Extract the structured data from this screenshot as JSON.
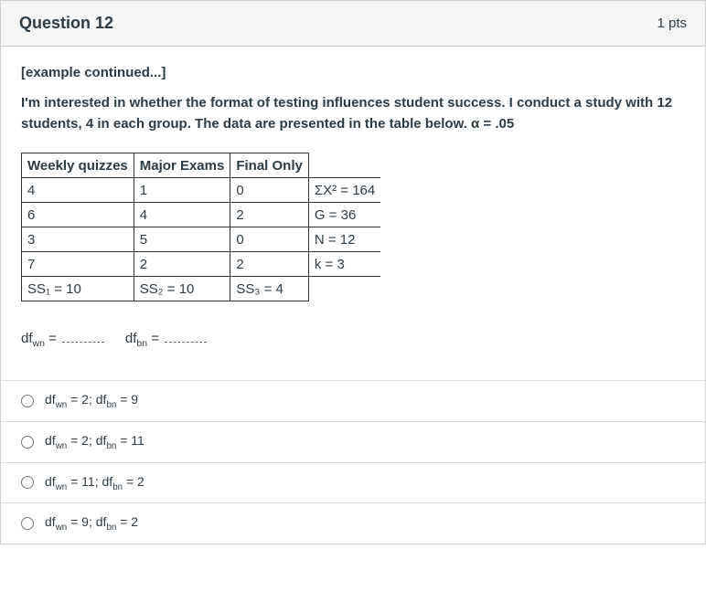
{
  "header": {
    "title": "Question 12",
    "points": "1 pts"
  },
  "prompt": {
    "sub": "[example continued...]",
    "main": "I'm interested in whether the format of testing influences student success.  I conduct a study with 12 students, 4 in each group.  The data are presented in the table below.  α = .05"
  },
  "table": {
    "headers": [
      "Weekly quizzes",
      "Major Exams",
      "Final Only"
    ],
    "rows": [
      {
        "c1": "4",
        "c2": "1",
        "c3": "0",
        "stat": "ΣX² = 164"
      },
      {
        "c1": "6",
        "c2": "4",
        "c3": "2",
        "stat": "G = 36"
      },
      {
        "c1": "3",
        "c2": "5",
        "c3": "0",
        "stat": "N = 12"
      },
      {
        "c1": "7",
        "c2": "2",
        "c3": "2",
        "stat": "k = 3"
      }
    ],
    "ss": {
      "ss1": "SS₁ = 10",
      "ss2": "SS₂ = 10",
      "ss3": "SS₃ = 4"
    }
  },
  "fill": {
    "label1_pre": "df",
    "label1_sub": "wn",
    "eq": " = ",
    "label2_pre": "df",
    "label2_sub": "bn"
  },
  "choices": [
    {
      "pre1": "df",
      "sub1": "wn",
      "mid1": " = 2; ",
      "pre2": "df",
      "sub2": "bn",
      "mid2": " = 9"
    },
    {
      "pre1": "df",
      "sub1": "wn",
      "mid1": " = 2; ",
      "pre2": "df",
      "sub2": "bn",
      "mid2": " = 11"
    },
    {
      "pre1": "df",
      "sub1": "wn",
      "mid1": " = 11; ",
      "pre2": "df",
      "sub2": "bn",
      "mid2": " = 2"
    },
    {
      "pre1": "df",
      "sub1": "wn",
      "mid1": " = 9; ",
      "pre2": "df",
      "sub2": "bn",
      "mid2": " = 2"
    }
  ]
}
